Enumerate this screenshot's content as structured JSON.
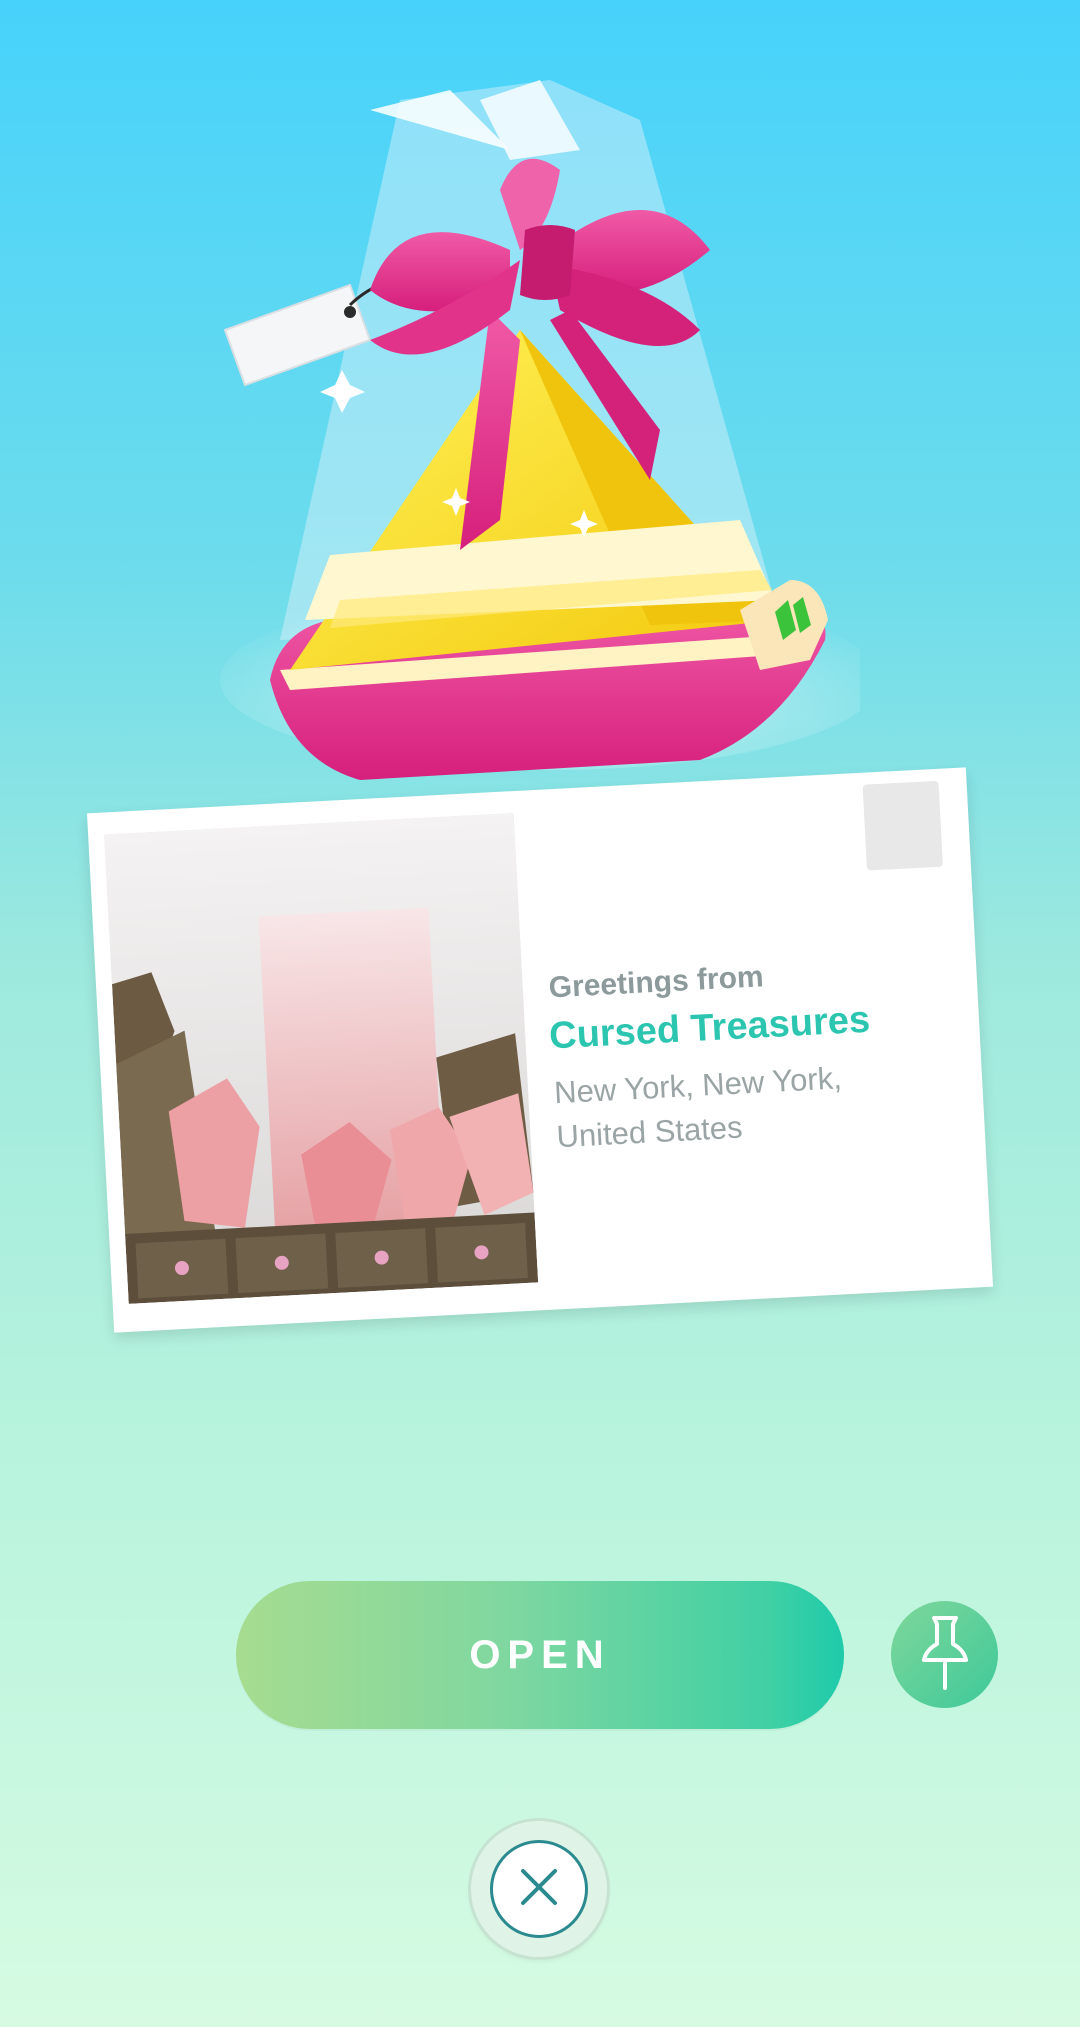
{
  "screen": {
    "background_top": "#47d2fb",
    "background_bottom": "#d6fbe2"
  },
  "gift": {
    "icon": "gift-icon",
    "bow_color": "#e2338a",
    "box_color": "#f6de1a"
  },
  "postcard": {
    "greeting": "Greetings from",
    "poi_name": "Cursed Treasures",
    "location": "New York, New York, United States",
    "accent_color": "#2cc6b0"
  },
  "actions": {
    "open_label": "OPEN",
    "pin_icon": "pin-icon",
    "close_icon": "close-icon"
  }
}
